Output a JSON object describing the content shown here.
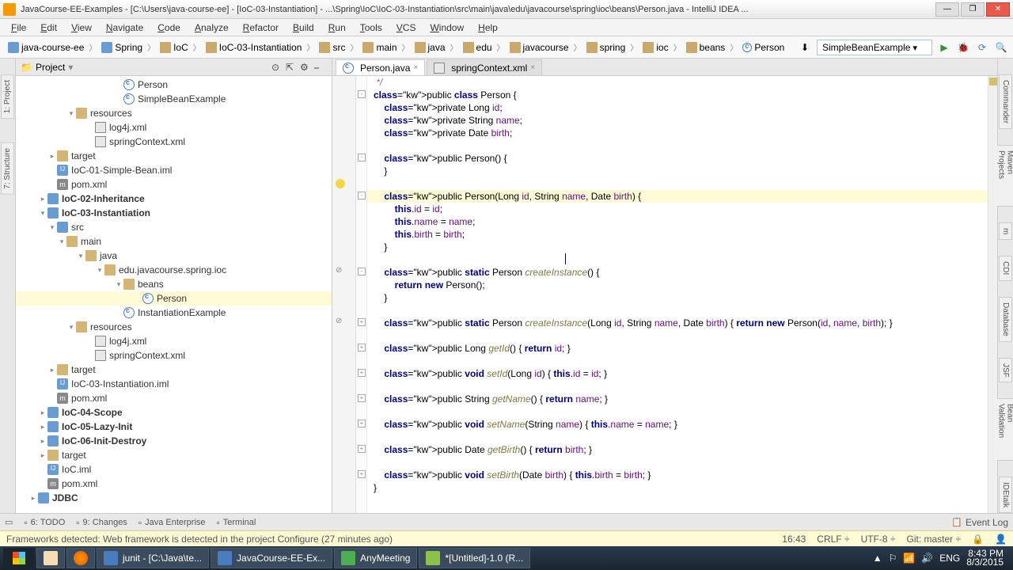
{
  "titlebar": {
    "text": "JavaCourse-EE-Examples - [C:\\Users\\java-course-ee] - [IoC-03-Instantiation] - ...\\Spring\\IoC\\IoC-03-Instantiation\\src\\main\\java\\edu\\javacourse\\spring\\ioc\\beans\\Person.java - IntelliJ IDEA ..."
  },
  "menu": [
    "File",
    "Edit",
    "View",
    "Navigate",
    "Code",
    "Analyze",
    "Refactor",
    "Build",
    "Run",
    "Tools",
    "VCS",
    "Window",
    "Help"
  ],
  "breadcrumb": [
    "java-course-ee",
    "Spring",
    "IoC",
    "IoC-03-Instantiation",
    "src",
    "main",
    "java",
    "edu",
    "javacourse",
    "spring",
    "ioc",
    "beans",
    "Person"
  ],
  "run_config": "SimpleBeanExample",
  "project": {
    "header": "Project",
    "tree": [
      {
        "depth": 10,
        "icon": "class",
        "label": "Person",
        "selected": false
      },
      {
        "depth": 10,
        "icon": "class",
        "label": "SimpleBeanExample"
      },
      {
        "depth": 5,
        "toggle": "▾",
        "icon": "dir-res",
        "label": "resources"
      },
      {
        "depth": 7,
        "icon": "xml",
        "label": "log4j.xml"
      },
      {
        "depth": 7,
        "icon": "xml",
        "label": "springContext.xml"
      },
      {
        "depth": 3,
        "toggle": "▸",
        "icon": "dir",
        "label": "target"
      },
      {
        "depth": 3,
        "icon": "iml",
        "label": "IoC-01-Simple-Bean.iml"
      },
      {
        "depth": 3,
        "icon": "m",
        "label": "pom.xml"
      },
      {
        "depth": 2,
        "toggle": "▸",
        "icon": "module",
        "label": "IoC-02-Inheritance",
        "bold": true
      },
      {
        "depth": 2,
        "toggle": "▾",
        "icon": "module",
        "label": "IoC-03-Instantiation",
        "bold": true
      },
      {
        "depth": 3,
        "toggle": "▾",
        "icon": "module",
        "label": "src"
      },
      {
        "depth": 4,
        "toggle": "▾",
        "icon": "dir",
        "label": "main"
      },
      {
        "depth": 6,
        "toggle": "▾",
        "icon": "dir",
        "label": "java"
      },
      {
        "depth": 8,
        "toggle": "▾",
        "icon": "dir",
        "label": "edu.javacourse.spring.ioc"
      },
      {
        "depth": 10,
        "toggle": "▾",
        "icon": "dir",
        "label": "beans"
      },
      {
        "depth": 12,
        "icon": "class",
        "label": "Person",
        "selected": true
      },
      {
        "depth": 10,
        "icon": "class",
        "label": "InstantiationExample"
      },
      {
        "depth": 5,
        "toggle": "▾",
        "icon": "dir-res",
        "label": "resources"
      },
      {
        "depth": 7,
        "icon": "xml",
        "label": "log4j.xml"
      },
      {
        "depth": 7,
        "icon": "xml",
        "label": "springContext.xml"
      },
      {
        "depth": 3,
        "toggle": "▸",
        "icon": "dir",
        "label": "target"
      },
      {
        "depth": 3,
        "icon": "iml",
        "label": "IoC-03-Instantiation.iml"
      },
      {
        "depth": 3,
        "icon": "m",
        "label": "pom.xml"
      },
      {
        "depth": 2,
        "toggle": "▸",
        "icon": "module",
        "label": "IoC-04-Scope",
        "bold": true
      },
      {
        "depth": 2,
        "toggle": "▸",
        "icon": "module",
        "label": "IoC-05-Lazy-Init",
        "bold": true
      },
      {
        "depth": 2,
        "toggle": "▸",
        "icon": "module",
        "label": "IoC-06-Init-Destroy",
        "bold": true
      },
      {
        "depth": 2,
        "toggle": "▸",
        "icon": "dir",
        "label": "target"
      },
      {
        "depth": 2,
        "icon": "iml",
        "label": "IoC.iml"
      },
      {
        "depth": 2,
        "icon": "m",
        "label": "pom.xml"
      },
      {
        "depth": 1,
        "toggle": "▸",
        "icon": "module",
        "label": "JDBC",
        "bold": true
      }
    ]
  },
  "tabs": [
    {
      "label": "Person.java",
      "active": true,
      "icon": "class"
    },
    {
      "label": "springContext.xml",
      "active": false,
      "icon": "xml"
    }
  ],
  "left_tabs": [
    "1: Project",
    "7: Structure"
  ],
  "right_tabs": [
    "Commander",
    "Maven Projects",
    "m",
    "CDI",
    "Database",
    "JSF",
    "Bean Validation",
    "IDEtalk"
  ],
  "bottom_tools": [
    {
      "icon": "todo",
      "label": "6: TODO"
    },
    {
      "icon": "changes",
      "label": "9: Changes"
    },
    {
      "icon": "je",
      "label": "Java Enterprise"
    },
    {
      "icon": "term",
      "label": "Terminal"
    }
  ],
  "event_log": "Event Log",
  "status": {
    "message": "Frameworks detected: Web framework is detected in the project Configure (27 minutes ago)",
    "time": "16:43",
    "line_ending": "CRLF",
    "encoding": "UTF-8",
    "git": "Git: master"
  },
  "taskbar": {
    "items": [
      {
        "icon": "folder",
        "label": ""
      },
      {
        "icon": "ff",
        "label": ""
      },
      {
        "icon": "ij",
        "label": "junit - [C:\\Java\\te..."
      },
      {
        "icon": "ij",
        "label": "JavaCourse-EE-Ex..."
      },
      {
        "icon": "am",
        "label": "AnyMeeting"
      },
      {
        "icon": "np",
        "label": "*[Untitled]-1.0 (R..."
      }
    ],
    "tray": {
      "lang": "ENG",
      "time": "8:43 PM",
      "date": "8/3/2015"
    }
  },
  "code": {
    "lines": [
      {
        "t": " */",
        "cls": "cmt"
      },
      {
        "t": "public class Person {"
      },
      {
        "t": "    private Long id;"
      },
      {
        "t": "    private String name;"
      },
      {
        "t": "    private Date birth;"
      },
      {
        "t": ""
      },
      {
        "t": "    public Person() {"
      },
      {
        "t": "    }"
      },
      {
        "t": ""
      },
      {
        "t": "    public Person(Long id, String name, Date birth) {",
        "hl": true
      },
      {
        "t": "        this.id = id;"
      },
      {
        "t": "        this.name = name;"
      },
      {
        "t": "        this.birth = birth;"
      },
      {
        "t": "    }"
      },
      {
        "t": ""
      },
      {
        "t": "    public static Person createInstance() {"
      },
      {
        "t": "        return new Person();"
      },
      {
        "t": "    }"
      },
      {
        "t": ""
      },
      {
        "t": "    public static Person createInstance(Long id, String name, Date birth) { return new Person(id, name, birth); }"
      },
      {
        "t": ""
      },
      {
        "t": "    public Long getId() { return id; }"
      },
      {
        "t": ""
      },
      {
        "t": "    public void setId(Long id) { this.id = id; }"
      },
      {
        "t": ""
      },
      {
        "t": "    public String getName() { return name; }"
      },
      {
        "t": ""
      },
      {
        "t": "    public void setName(String name) { this.name = name; }"
      },
      {
        "t": ""
      },
      {
        "t": "    public Date getBirth() { return birth; }"
      },
      {
        "t": ""
      },
      {
        "t": "    public void setBirth(Date birth) { this.birth = birth; }"
      },
      {
        "t": "}"
      }
    ]
  }
}
